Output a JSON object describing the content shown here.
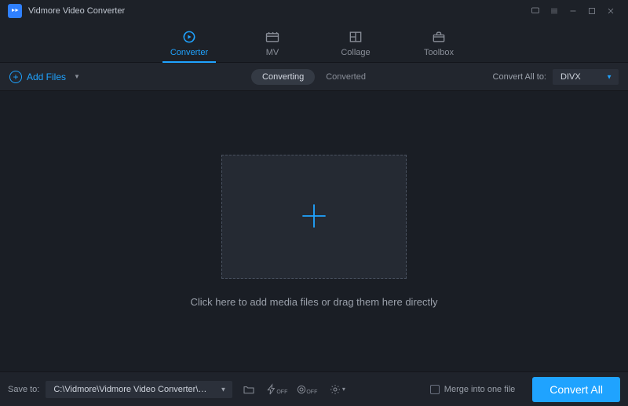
{
  "titlebar": {
    "app_name": "Vidmore Video Converter"
  },
  "tabs": {
    "converter": "Converter",
    "mv": "MV",
    "collage": "Collage",
    "toolbox": "Toolbox"
  },
  "subbar": {
    "add_files": "Add Files",
    "converting": "Converting",
    "converted": "Converted",
    "convert_all_to": "Convert All to:",
    "format_selected": "DIVX"
  },
  "main": {
    "drop_text": "Click here to add media files or drag them here directly"
  },
  "bottom": {
    "save_to": "Save to:",
    "path": "C:\\Vidmore\\Vidmore Video Converter\\Converted",
    "merge_label": "Merge into one file",
    "convert_all_btn": "Convert All"
  }
}
